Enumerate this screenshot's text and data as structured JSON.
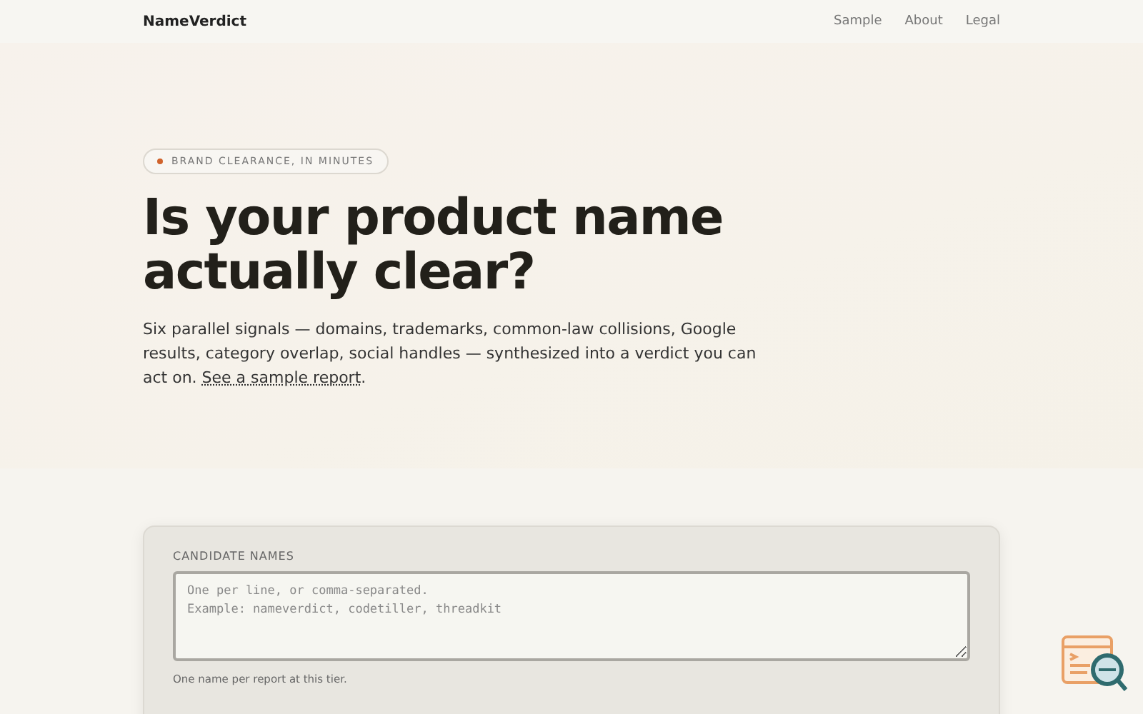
{
  "header": {
    "brand": "NameVerdict",
    "nav": [
      "Sample",
      "About",
      "Legal"
    ]
  },
  "hero": {
    "badge": "BRAND CLEARANCE, IN MINUTES",
    "title": "Is your product name actually clear?",
    "intro": "Six parallel signals — domains, trademarks, common-law collisions, Google results, category overlap, social handles — synthesized into a verdict you can act on. ",
    "intro_link": "See a sample report",
    "intro_end": "."
  },
  "form": {
    "label": "CANDIDATE NAMES",
    "placeholder": "One per line, or comma-separated.\nExample: nameverdict, codetiller, threadkit",
    "hint": "One name per report at this tier."
  }
}
